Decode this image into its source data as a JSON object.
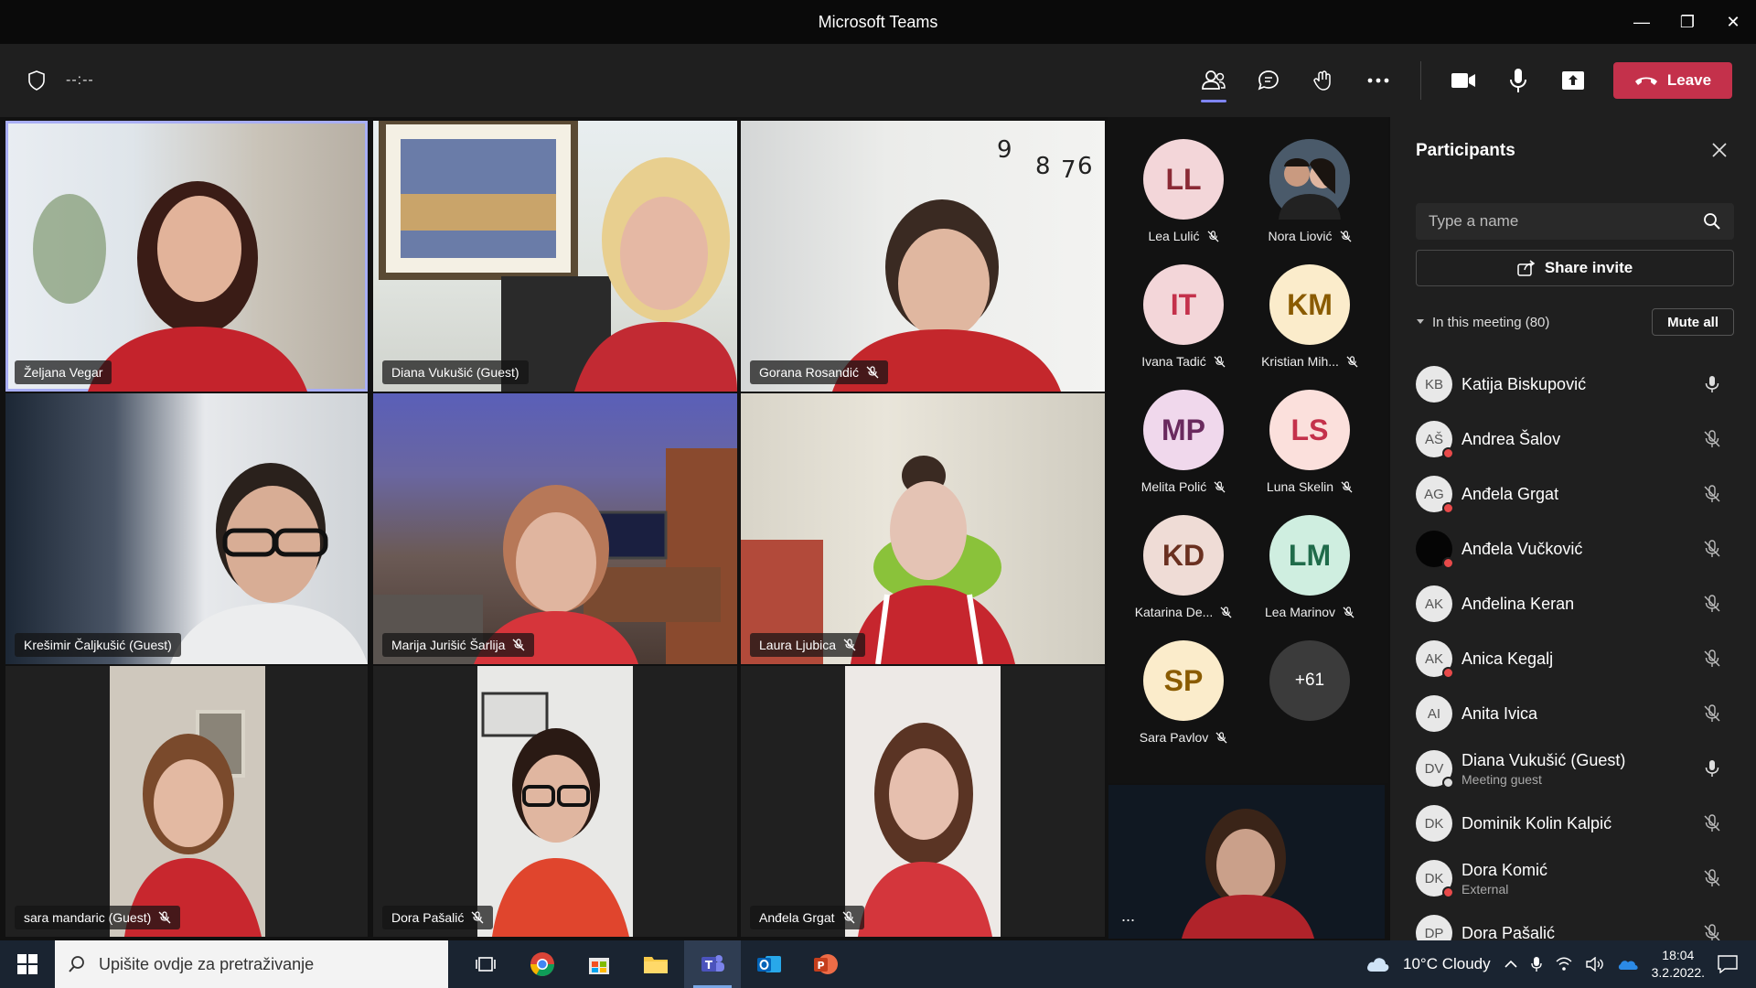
{
  "window": {
    "title": "Microsoft Teams"
  },
  "toolbar": {
    "timer": "--:--",
    "leave_label": "Leave"
  },
  "tiles": [
    {
      "name": "Željana Vegar",
      "muted": false
    },
    {
      "name": "Diana Vukušić (Guest)",
      "muted": false
    },
    {
      "name": "Gorana Rosandić",
      "muted": true
    },
    {
      "name": "Krešimir Čaljkušić (Guest)",
      "muted": false
    },
    {
      "name": "Marija Jurišić Šarlija",
      "muted": true
    },
    {
      "name": "Laura Ljubica",
      "muted": true
    },
    {
      "name": "sara mandaric (Guest)",
      "muted": true
    },
    {
      "name": "Dora Pašalić",
      "muted": true
    },
    {
      "name": "Anđela Grgat",
      "muted": true
    }
  ],
  "roster": [
    {
      "initials": "LL",
      "name": "Lea Lulić",
      "bg": "#f3d6d9",
      "fg": "#8a2a35"
    },
    {
      "initials": "",
      "name": "Nora Liović",
      "bg": "#3a4a5a",
      "fg": "#ffffff"
    },
    {
      "initials": "IT",
      "name": "Ivana Tadić",
      "bg": "#f3d6d9",
      "fg": "#c4314b"
    },
    {
      "initials": "KM",
      "name": "Kristian Mih...",
      "bg": "#fbeccb",
      "fg": "#8a5b00"
    },
    {
      "initials": "MP",
      "name": "Melita Polić",
      "bg": "#f0d8ec",
      "fg": "#6a2a5e"
    },
    {
      "initials": "LS",
      "name": "Luna Skelin",
      "bg": "#fbe0dc",
      "fg": "#c4314b"
    },
    {
      "initials": "KD",
      "name": "Katarina De...",
      "bg": "#efdcd6",
      "fg": "#6a3020"
    },
    {
      "initials": "LM",
      "name": "Lea Marinov",
      "bg": "#cfeee0",
      "fg": "#1f6b4a"
    },
    {
      "initials": "SP",
      "name": "Sara Pavlov",
      "bg": "#fbeccb",
      "fg": "#8a5b00"
    },
    {
      "initials": "+61",
      "name": "",
      "bg": "#3b3b3b",
      "fg": "#ffffff"
    }
  ],
  "self_tile": {
    "more": "..."
  },
  "panel": {
    "title": "Participants",
    "search_placeholder": "Type a name",
    "share_label": "Share invite",
    "section_label": "In this meeting (80)",
    "mute_all_label": "Mute all",
    "participants": [
      {
        "initials": "KB",
        "name": "Katija Biskupović",
        "sub": "",
        "mic": "on",
        "status": "none"
      },
      {
        "initials": "AŠ",
        "name": "Andrea Šalov",
        "sub": "",
        "mic": "off",
        "status": "busy"
      },
      {
        "initials": "AG",
        "name": "Anđela Grgat",
        "sub": "",
        "mic": "off",
        "status": "busy"
      },
      {
        "initials": "",
        "name": "Anđela Vučković",
        "sub": "",
        "mic": "off",
        "status": "busy"
      },
      {
        "initials": "AK",
        "name": "Anđelina Keran",
        "sub": "",
        "mic": "off",
        "status": "none"
      },
      {
        "initials": "AK",
        "name": "Anica Kegalj",
        "sub": "",
        "mic": "off",
        "status": "busy"
      },
      {
        "initials": "AI",
        "name": "Anita Ivica",
        "sub": "",
        "mic": "off",
        "status": "none"
      },
      {
        "initials": "DV",
        "name": "Diana Vukušić (Guest)",
        "sub": "Meeting guest",
        "mic": "on",
        "status": "away"
      },
      {
        "initials": "DK",
        "name": "Dominik Kolin Kalpić",
        "sub": "",
        "mic": "off",
        "status": "none"
      },
      {
        "initials": "DK",
        "name": "Dora Komić",
        "sub": "External",
        "mic": "off",
        "status": "busy"
      },
      {
        "initials": "DP",
        "name": "Dora Pašalić",
        "sub": "",
        "mic": "off",
        "status": "none"
      }
    ]
  },
  "taskbar": {
    "search_placeholder": "Upišite ovdje za pretraživanje",
    "weather": "10°C  Cloudy",
    "time": "18:04",
    "date": "3.2.2022."
  }
}
